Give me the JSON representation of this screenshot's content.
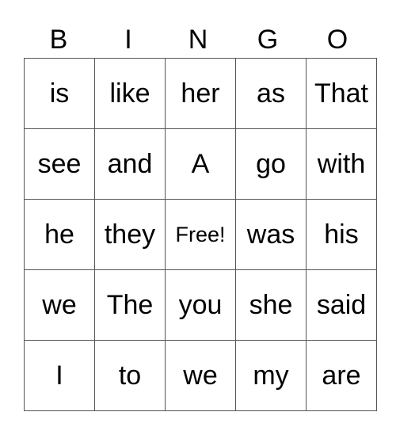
{
  "header": [
    "B",
    "I",
    "N",
    "G",
    "O"
  ],
  "rows": [
    [
      "is",
      "like",
      "her",
      "as",
      "That"
    ],
    [
      "see",
      "and",
      "A",
      "go",
      "with"
    ],
    [
      "he",
      "they",
      "Free!",
      "was",
      "his"
    ],
    [
      "we",
      "The",
      "you",
      "she",
      "said"
    ],
    [
      "I",
      "to",
      "we",
      "my",
      "are"
    ]
  ],
  "free_label": "Free!"
}
